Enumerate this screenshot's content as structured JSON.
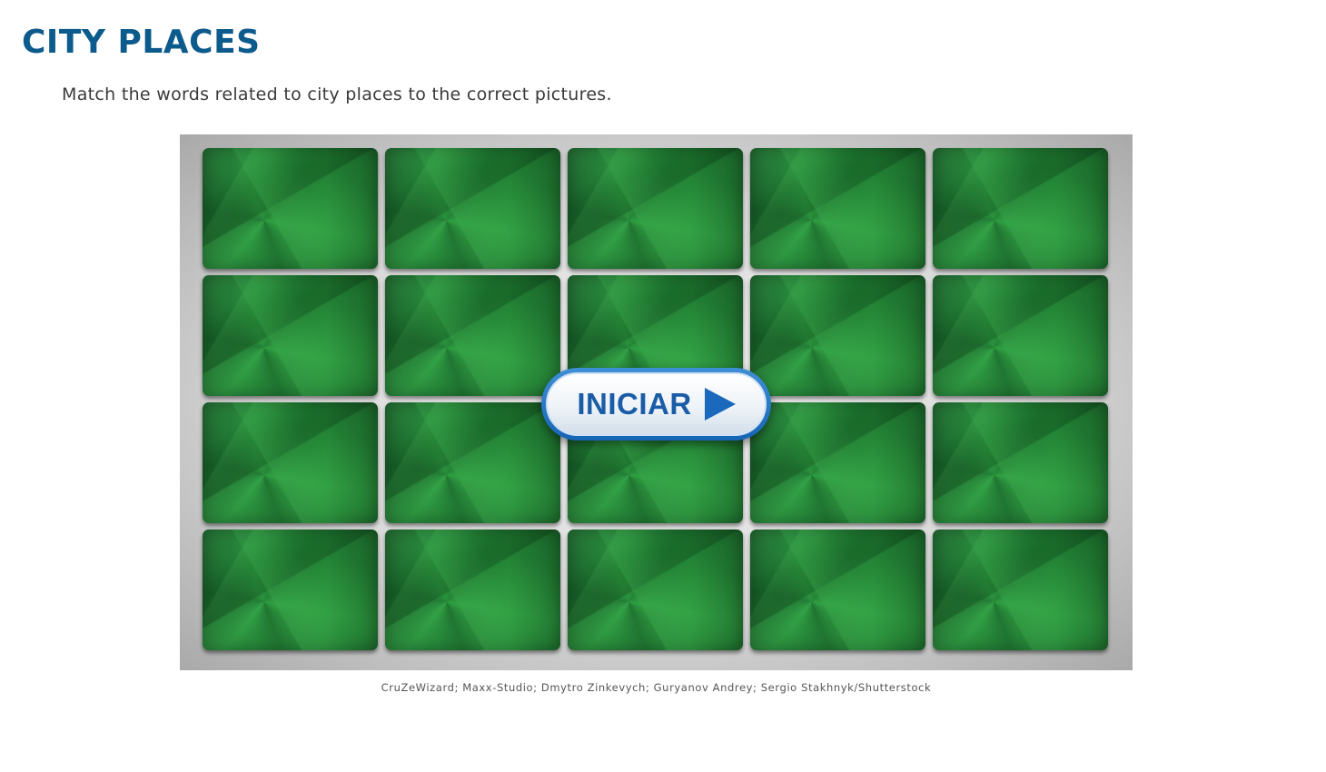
{
  "header": {
    "title": "CITY PLACES",
    "instructions": "Match the words related to city places to the correct pictures."
  },
  "game": {
    "start_button_label": "INICIAR",
    "start_icon": "play-arrow-icon",
    "rows": 4,
    "columns": 5,
    "card_count": 20,
    "card_state": "face-down"
  },
  "credits": "CruZeWizard; Maxx-Studio; Dmytro Zinkevych; Guryanov Andrey; Sergio Stakhnyk/Shutterstock",
  "colors": {
    "title": "#0d5b8c",
    "card_back": "#1e7a33",
    "button_text": "#1a5ca6",
    "button_border": "#1664b5"
  }
}
